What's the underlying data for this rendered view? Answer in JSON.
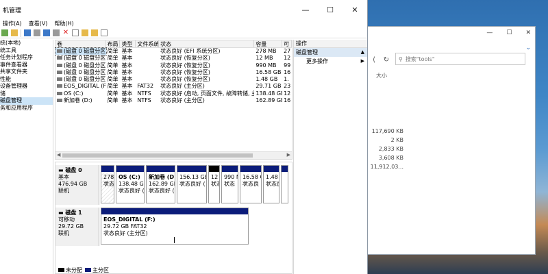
{
  "bg_window": {
    "controls": [
      "—",
      "☐",
      "✕"
    ],
    "nav": [
      "⟨",
      "↻"
    ],
    "search_placeholder": "搜索\"tools\"",
    "col_size": "大小",
    "sizes": [
      "117,690 KB",
      "2 KB",
      "2,833 KB",
      "3,608 KB",
      "11,912,03..."
    ],
    "chevron": "⌄"
  },
  "window": {
    "title": "机管理",
    "controls": [
      "—",
      "☐",
      "✕"
    ],
    "menu": [
      "操作(A)",
      "查看(V)",
      "帮助(H)"
    ]
  },
  "tree": {
    "items": [
      "统(本地)",
      "统工具",
      "任务计划程序",
      "事件查看器",
      "共享文件夹",
      "性能",
      "设备管理器",
      "储",
      "磁盘管理",
      "务和应用程序"
    ]
  },
  "volume_list": {
    "headers": [
      "卷",
      "布局",
      "类型",
      "文件系统",
      "状态",
      "容量",
      "可"
    ],
    "rows": [
      [
        "(磁盘 0 磁盘分区 1)",
        "简单",
        "基本",
        "",
        "状态良好 (EFI 系统分区)",
        "278 MB",
        "27"
      ],
      [
        "(磁盘 0 磁盘分区 4)",
        "简单",
        "基本",
        "",
        "状态良好 (恢复分区)",
        "12 MB",
        "12"
      ],
      [
        "(磁盘 0 磁盘分区 5)",
        "简单",
        "基本",
        "",
        "状态良好 (恢复分区)",
        "990 MB",
        "99"
      ],
      [
        "(磁盘 0 磁盘分区 6)",
        "简单",
        "基本",
        "",
        "状态良好 (恢复分区)",
        "16.58 GB",
        "16"
      ],
      [
        "(磁盘 0 磁盘分区 7)",
        "简单",
        "基本",
        "",
        "状态良好 (恢复分区)",
        "1.48 GB",
        "1."
      ],
      [
        "EOS_DIGITAL (F:)",
        "简单",
        "基本",
        "FAT32",
        "状态良好 (主分区)",
        "29.71 GB",
        "23"
      ],
      [
        "OS (C:)",
        "简单",
        "基本",
        "NTFS",
        "状态良好 (启动, 页面文件, 故障转储, 主分区)",
        "138.48 GB",
        "12"
      ],
      [
        "新加卷 (D:)",
        "简单",
        "基本",
        "NTFS",
        "状态良好 (主分区)",
        "162.89 GB",
        "16"
      ]
    ]
  },
  "disk0": {
    "name": "磁盘 0",
    "type": "基本",
    "size": "476.94 GB",
    "status": "联机",
    "partitions": [
      {
        "l1": "",
        "l2": "278",
        "l3": "状态",
        "bar": "navy"
      },
      {
        "l1": "OS (C:)",
        "l2": "138.48 GB",
        "l3": "状态良好 (",
        "bar": "navy"
      },
      {
        "l1": "新加卷 (D:)",
        "l2": "162.89 GB",
        "l3": "状态良好 (",
        "bar": "navy"
      },
      {
        "l1": "",
        "l2": "156.13 GB",
        "l3": "状态良好 (",
        "bar": "navy"
      },
      {
        "l1": "",
        "l2": "12",
        "l3": "状态",
        "bar": "black"
      },
      {
        "l1": "",
        "l2": "990 M",
        "l3": "状态",
        "bar": "navy"
      },
      {
        "l1": "",
        "l2": "16.58 G",
        "l3": "状态良",
        "bar": "navy"
      },
      {
        "l1": "",
        "l2": "1.48 (",
        "l3": "状态良",
        "bar": "navy"
      },
      {
        "l1": "",
        "l2": "",
        "l3": "",
        "bar": "navy"
      }
    ]
  },
  "disk1": {
    "name": "磁盘 1",
    "type": "可移动",
    "size": "29.72 GB",
    "status": "联机",
    "partition": {
      "l1": "EOS_DIGITAL (F:)",
      "l2": "29.72 GB FAT32",
      "l3": "状态良好 (主分区)"
    }
  },
  "legend": [
    "未分配",
    "主分区"
  ],
  "actions": {
    "header": "操作",
    "section": "磁盘管理",
    "more": "更多操作",
    "arrow_up": "▲",
    "arrow_right": "▶"
  },
  "scroll": {
    "left": "◀",
    "right": "▶"
  },
  "colors": {
    "primary_partition": "#0b1c7a",
    "unallocated": "#000000",
    "selection": "#cce4f7"
  }
}
